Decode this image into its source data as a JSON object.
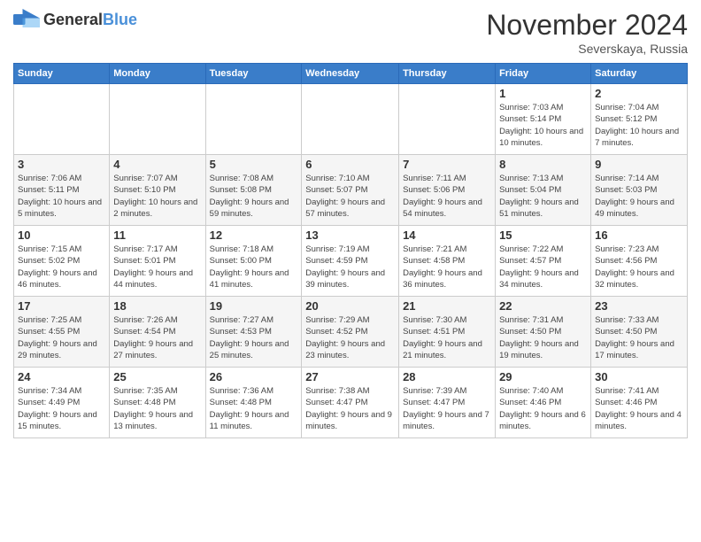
{
  "logo": {
    "general": "General",
    "blue": "Blue"
  },
  "title": "November 2024",
  "subtitle": "Severskaya, Russia",
  "days_of_week": [
    "Sunday",
    "Monday",
    "Tuesday",
    "Wednesday",
    "Thursday",
    "Friday",
    "Saturday"
  ],
  "weeks": [
    [
      {
        "day": "",
        "info": ""
      },
      {
        "day": "",
        "info": ""
      },
      {
        "day": "",
        "info": ""
      },
      {
        "day": "",
        "info": ""
      },
      {
        "day": "",
        "info": ""
      },
      {
        "day": "1",
        "info": "Sunrise: 7:03 AM\nSunset: 5:14 PM\nDaylight: 10 hours and 10 minutes."
      },
      {
        "day": "2",
        "info": "Sunrise: 7:04 AM\nSunset: 5:12 PM\nDaylight: 10 hours and 7 minutes."
      }
    ],
    [
      {
        "day": "3",
        "info": "Sunrise: 7:06 AM\nSunset: 5:11 PM\nDaylight: 10 hours and 5 minutes."
      },
      {
        "day": "4",
        "info": "Sunrise: 7:07 AM\nSunset: 5:10 PM\nDaylight: 10 hours and 2 minutes."
      },
      {
        "day": "5",
        "info": "Sunrise: 7:08 AM\nSunset: 5:08 PM\nDaylight: 9 hours and 59 minutes."
      },
      {
        "day": "6",
        "info": "Sunrise: 7:10 AM\nSunset: 5:07 PM\nDaylight: 9 hours and 57 minutes."
      },
      {
        "day": "7",
        "info": "Sunrise: 7:11 AM\nSunset: 5:06 PM\nDaylight: 9 hours and 54 minutes."
      },
      {
        "day": "8",
        "info": "Sunrise: 7:13 AM\nSunset: 5:04 PM\nDaylight: 9 hours and 51 minutes."
      },
      {
        "day": "9",
        "info": "Sunrise: 7:14 AM\nSunset: 5:03 PM\nDaylight: 9 hours and 49 minutes."
      }
    ],
    [
      {
        "day": "10",
        "info": "Sunrise: 7:15 AM\nSunset: 5:02 PM\nDaylight: 9 hours and 46 minutes."
      },
      {
        "day": "11",
        "info": "Sunrise: 7:17 AM\nSunset: 5:01 PM\nDaylight: 9 hours and 44 minutes."
      },
      {
        "day": "12",
        "info": "Sunrise: 7:18 AM\nSunset: 5:00 PM\nDaylight: 9 hours and 41 minutes."
      },
      {
        "day": "13",
        "info": "Sunrise: 7:19 AM\nSunset: 4:59 PM\nDaylight: 9 hours and 39 minutes."
      },
      {
        "day": "14",
        "info": "Sunrise: 7:21 AM\nSunset: 4:58 PM\nDaylight: 9 hours and 36 minutes."
      },
      {
        "day": "15",
        "info": "Sunrise: 7:22 AM\nSunset: 4:57 PM\nDaylight: 9 hours and 34 minutes."
      },
      {
        "day": "16",
        "info": "Sunrise: 7:23 AM\nSunset: 4:56 PM\nDaylight: 9 hours and 32 minutes."
      }
    ],
    [
      {
        "day": "17",
        "info": "Sunrise: 7:25 AM\nSunset: 4:55 PM\nDaylight: 9 hours and 29 minutes."
      },
      {
        "day": "18",
        "info": "Sunrise: 7:26 AM\nSunset: 4:54 PM\nDaylight: 9 hours and 27 minutes."
      },
      {
        "day": "19",
        "info": "Sunrise: 7:27 AM\nSunset: 4:53 PM\nDaylight: 9 hours and 25 minutes."
      },
      {
        "day": "20",
        "info": "Sunrise: 7:29 AM\nSunset: 4:52 PM\nDaylight: 9 hours and 23 minutes."
      },
      {
        "day": "21",
        "info": "Sunrise: 7:30 AM\nSunset: 4:51 PM\nDaylight: 9 hours and 21 minutes."
      },
      {
        "day": "22",
        "info": "Sunrise: 7:31 AM\nSunset: 4:50 PM\nDaylight: 9 hours and 19 minutes."
      },
      {
        "day": "23",
        "info": "Sunrise: 7:33 AM\nSunset: 4:50 PM\nDaylight: 9 hours and 17 minutes."
      }
    ],
    [
      {
        "day": "24",
        "info": "Sunrise: 7:34 AM\nSunset: 4:49 PM\nDaylight: 9 hours and 15 minutes."
      },
      {
        "day": "25",
        "info": "Sunrise: 7:35 AM\nSunset: 4:48 PM\nDaylight: 9 hours and 13 minutes."
      },
      {
        "day": "26",
        "info": "Sunrise: 7:36 AM\nSunset: 4:48 PM\nDaylight: 9 hours and 11 minutes."
      },
      {
        "day": "27",
        "info": "Sunrise: 7:38 AM\nSunset: 4:47 PM\nDaylight: 9 hours and 9 minutes."
      },
      {
        "day": "28",
        "info": "Sunrise: 7:39 AM\nSunset: 4:47 PM\nDaylight: 9 hours and 7 minutes."
      },
      {
        "day": "29",
        "info": "Sunrise: 7:40 AM\nSunset: 4:46 PM\nDaylight: 9 hours and 6 minutes."
      },
      {
        "day": "30",
        "info": "Sunrise: 7:41 AM\nSunset: 4:46 PM\nDaylight: 9 hours and 4 minutes."
      }
    ]
  ]
}
